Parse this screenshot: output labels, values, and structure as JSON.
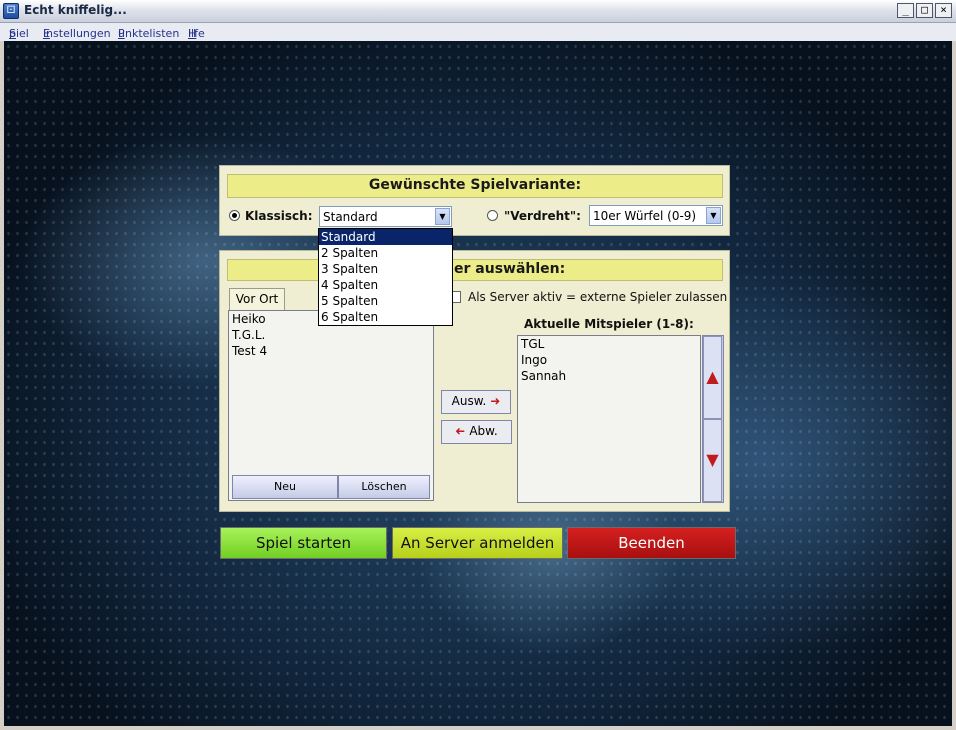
{
  "window": {
    "title": "Echt kniffelig...",
    "controls": [
      "_",
      "□",
      "×"
    ]
  },
  "menu": [
    {
      "label": "Spiel",
      "accel": "S",
      "rest": "piel"
    },
    {
      "label": "Einstellungen",
      "accel": "E",
      "rest": "instellungen"
    },
    {
      "label": "Punktelisten",
      "accel": "P",
      "rest": "unktelisten"
    },
    {
      "label": "Hilfe",
      "accel": "H",
      "rest": "ilfe"
    }
  ],
  "variant": {
    "header": "Gewünschte Spielvariante:",
    "klassisch_label": "Klassisch:",
    "klassisch_selected": true,
    "klassisch_value": "Standard",
    "verdreht_label": "\"Verdreht\":",
    "verdreht_selected": false,
    "verdreht_value": "10er Würfel (0-9)",
    "dropdown_options": [
      "Standard",
      "2 Spalten",
      "3 Spalten",
      "4 Spalten",
      "5 Spalten",
      "6 Spalten"
    ],
    "dropdown_selected_index": 0
  },
  "players": {
    "header": "Spieler auswählen:",
    "header_visible": "er auswählen:",
    "tab_label": "Vor Ort",
    "local_players": [
      "Heiko",
      "T.G.L.",
      "Test 4"
    ],
    "new_button": "Neu",
    "delete_button": "Löschen",
    "server_checkbox_label": "Als Server aktiv = externe Spieler zulassen",
    "server_checked": false,
    "current_label": "Aktuelle Mitspieler (1-8):",
    "current_players": [
      "TGL",
      "Ingo",
      "Sannah"
    ],
    "select_button": "Ausw.",
    "deselect_button": "Abw."
  },
  "actions": {
    "start": "Spiel starten",
    "server_login": "An Server anmelden",
    "quit": "Beenden"
  }
}
